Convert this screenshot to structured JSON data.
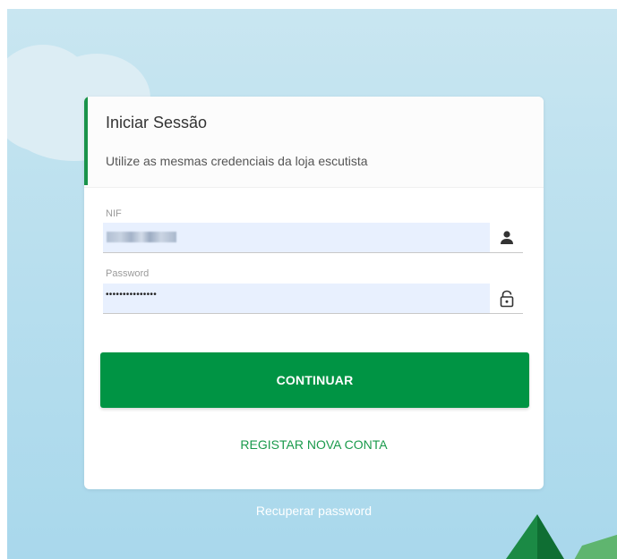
{
  "card": {
    "title": "Iniciar Sessão",
    "subtitle": "Utilize as mesmas credenciais da loja escutista"
  },
  "form": {
    "nif": {
      "label": "NIF",
      "value_obscured": true,
      "icon": "person-icon"
    },
    "password": {
      "label": "Password",
      "value_masked": "•••••••••••••••",
      "icon": "lock-icon"
    }
  },
  "actions": {
    "continue_label": "CONTINUAR",
    "register_label": "REGISTAR NOVA CONTA",
    "recover_label": "Recuperar password"
  },
  "colors": {
    "accent": "#19934a",
    "button": "#009444",
    "link": "#1a9a4c",
    "input_bg": "#e8f0fe",
    "background": "#b9dfee"
  }
}
